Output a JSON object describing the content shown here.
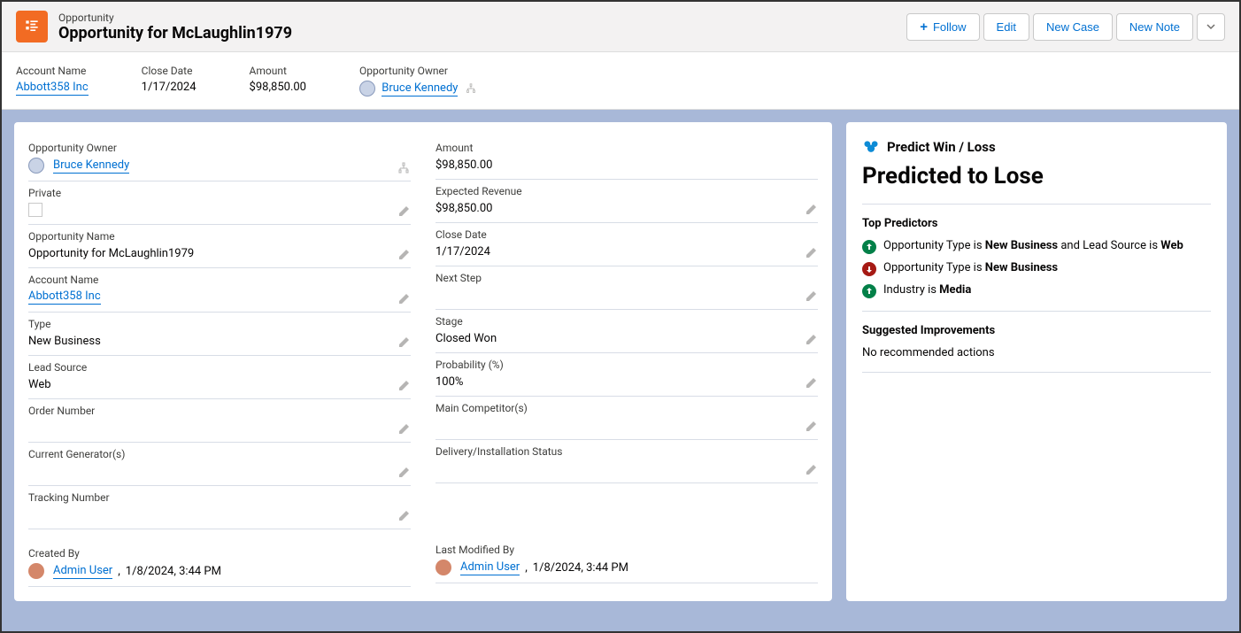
{
  "header": {
    "subtitle": "Opportunity",
    "title": "Opportunity for McLaughlin1979",
    "actions": {
      "follow": "Follow",
      "edit": "Edit",
      "new_case": "New Case",
      "new_note": "New Note"
    }
  },
  "summary": {
    "account_name_label": "Account Name",
    "account_name": "Abbott358 Inc",
    "close_date_label": "Close Date",
    "close_date": "1/17/2024",
    "amount_label": "Amount",
    "amount": "$98,850.00",
    "owner_label": "Opportunity Owner",
    "owner": "Bruce Kennedy"
  },
  "details": {
    "left": {
      "owner_label": "Opportunity Owner",
      "owner": "Bruce Kennedy",
      "private_label": "Private",
      "name_label": "Opportunity Name",
      "name": "Opportunity for McLaughlin1979",
      "account_label": "Account Name",
      "account": "Abbott358 Inc",
      "type_label": "Type",
      "type": "New Business",
      "lead_source_label": "Lead Source",
      "lead_source": "Web",
      "order_number_label": "Order Number",
      "order_number": "",
      "current_generators_label": "Current Generator(s)",
      "current_generators": "",
      "tracking_number_label": "Tracking Number",
      "tracking_number": "",
      "created_by_label": "Created By",
      "created_by_user": "Admin User",
      "created_by_date": "1/8/2024, 3:44 PM"
    },
    "right": {
      "amount_label": "Amount",
      "amount": "$98,850.00",
      "expected_revenue_label": "Expected Revenue",
      "expected_revenue": "$98,850.00",
      "close_date_label": "Close Date",
      "close_date": "1/17/2024",
      "next_step_label": "Next Step",
      "next_step": "",
      "stage_label": "Stage",
      "stage": "Closed Won",
      "probability_label": "Probability (%)",
      "probability": "100%",
      "main_competitors_label": "Main Competitor(s)",
      "main_competitors": "",
      "delivery_status_label": "Delivery/Installation Status",
      "delivery_status": "",
      "last_modified_label": "Last Modified By",
      "last_modified_user": "Admin User",
      "last_modified_date": "1/8/2024, 3:44 PM"
    }
  },
  "sidebar": {
    "header": "Predict Win / Loss",
    "prediction": "Predicted to Lose",
    "top_predictors_label": "Top Predictors",
    "predictors": [
      {
        "sign": "pos",
        "t1": "Opportunity Type is ",
        "b1": "New Business",
        "t2": " and Lead Source is ",
        "b2": "Web"
      },
      {
        "sign": "neg",
        "t1": "Opportunity Type is ",
        "b1": "New Business",
        "t2": "",
        "b2": ""
      },
      {
        "sign": "pos",
        "t1": "Industry is ",
        "b1": "Media",
        "t2": "",
        "b2": ""
      }
    ],
    "suggested_label": "Suggested Improvements",
    "suggested_msg": "No recommended actions"
  }
}
